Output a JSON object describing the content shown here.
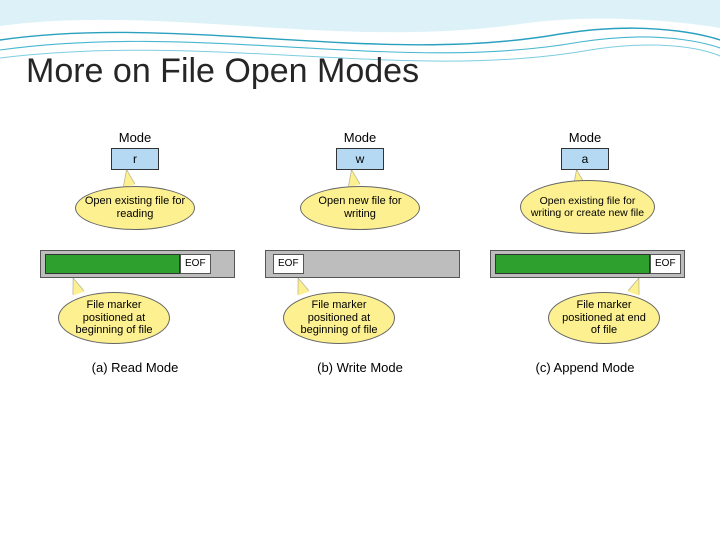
{
  "title": "More on File Open Modes",
  "modes": [
    {
      "label": "Mode",
      "letter": "r",
      "openDesc": "Open existing file for reading",
      "eof": "EOF",
      "markerDesc": "File marker positioned at beginning of file",
      "caption": "(a) Read Mode"
    },
    {
      "label": "Mode",
      "letter": "w",
      "openDesc": "Open new file for writing",
      "eof": "EOF",
      "markerDesc": "File marker positioned at beginning of file",
      "caption": "(b) Write Mode"
    },
    {
      "label": "Mode",
      "letter": "a",
      "openDesc": "Open existing file for writing or create new file",
      "eof": "EOF",
      "markerDesc": "File marker positioned at end of file",
      "caption": "(c) Append Mode"
    }
  ]
}
